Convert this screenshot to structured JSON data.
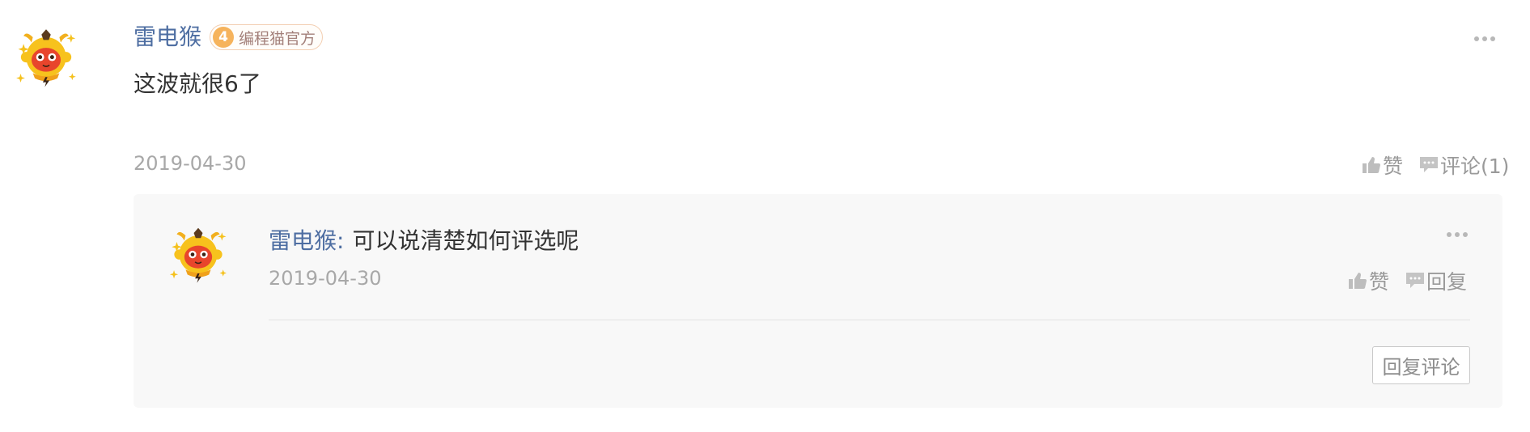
{
  "comment": {
    "author": "雷电猴",
    "badge": {
      "level": "4",
      "title": "编程猫官方"
    },
    "content": "这波就很6了",
    "date": "2019-04-30",
    "actions": {
      "like_label": "赞",
      "comment_label": "评论(1)"
    },
    "avatar_icon": "monkey-mascot-avatar",
    "more_icon": "more-dots-icon"
  },
  "reply": {
    "author": "雷电猴",
    "colon": ":",
    "content": "可以说清楚如何评选呢",
    "date": "2019-04-30",
    "actions": {
      "like_label": "赞",
      "reply_label": "回复"
    },
    "reply_comment_button": "回复评论"
  },
  "colors": {
    "author_name": "#4e6ea2",
    "text": "#333333",
    "meta": "#a8a8a8",
    "reply_background": "#f8f8f8",
    "badge_level": "#f6b35c"
  }
}
